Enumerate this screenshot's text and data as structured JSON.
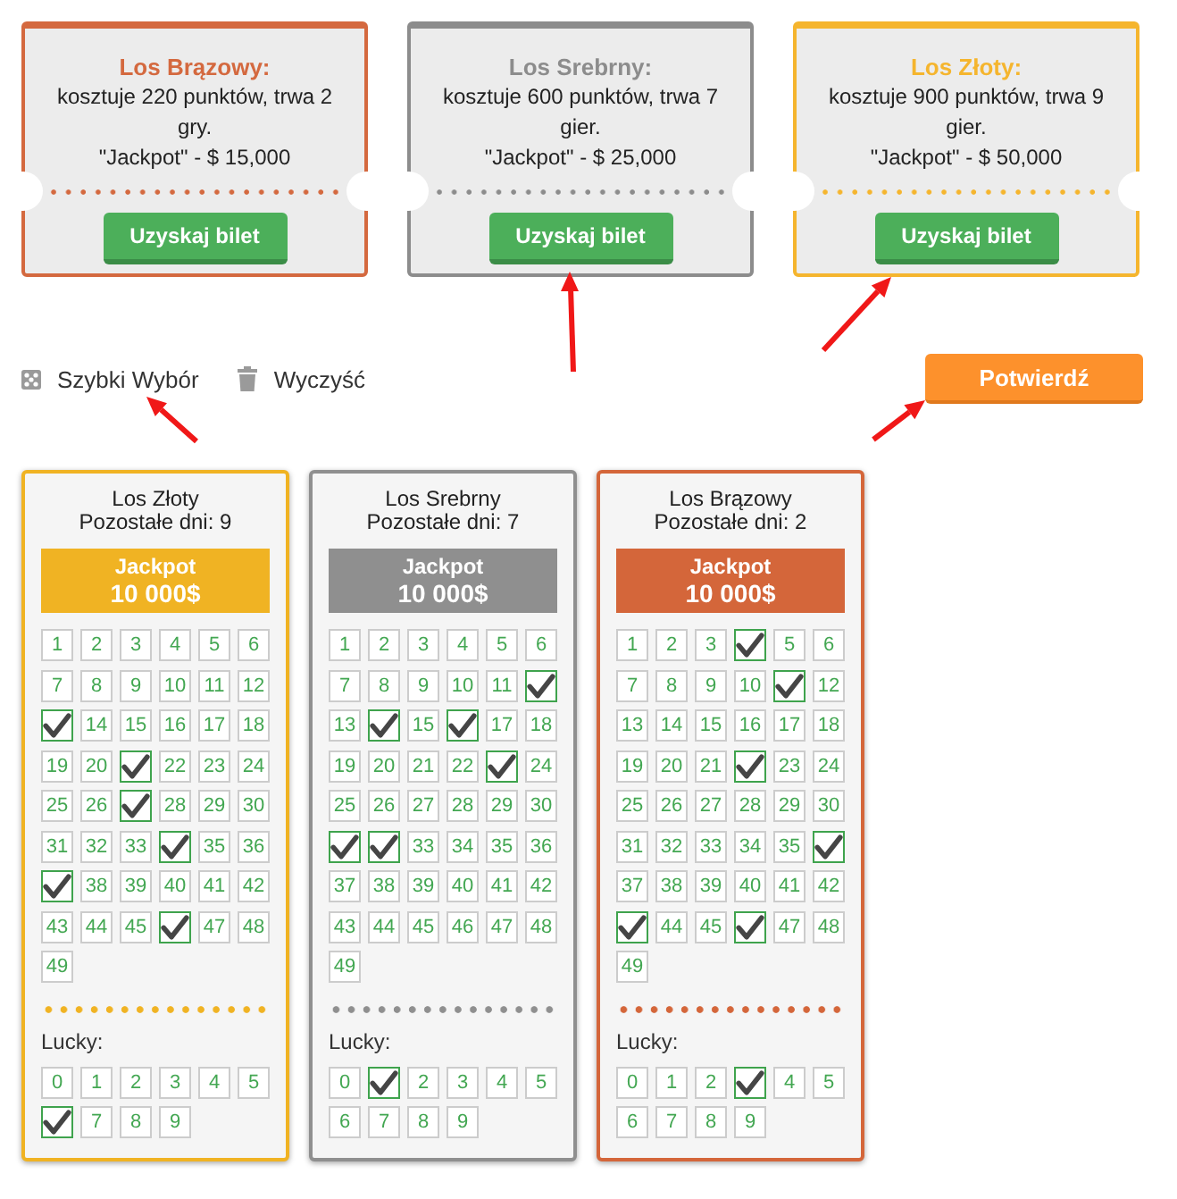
{
  "offers": [
    {
      "title": "Los Brązowy:",
      "color": "#d4693f",
      "description": "kosztuje 220 punktów, trwa 2 gry.",
      "jackpot": "\"Jackpot\" - $ 15,000",
      "button": "Uzyskaj bilet"
    },
    {
      "title": "Los Srebrny:",
      "color": "#8c8c8c",
      "description": "kosztuje 600 punktów, trwa 7 gier.",
      "jackpot": "\"Jackpot\" - $ 25,000",
      "button": "Uzyskaj bilet"
    },
    {
      "title": "Los Złoty:",
      "color": "#f5b52e",
      "description": "kosztuje 900 punktów, trwa 9 gier.",
      "jackpot": "\"Jackpot\" - $ 50,000",
      "button": "Uzyskaj bilet"
    }
  ],
  "toolbar": {
    "actions": [
      {
        "kind": "dice",
        "label": "Szybki Wybór"
      },
      {
        "kind": "trash",
        "label": "Wyczyść"
      }
    ],
    "confirm_button": "Potwierdź"
  },
  "tickets": [
    {
      "title": "Los Złoty",
      "days": "Pozostałe dni: 9",
      "color": "#f0b323",
      "jackpot_label": "Jackpot",
      "jackpot_amount": "10 000$",
      "lucky_label": "Lucky:",
      "numbers": [
        {
          "label": "1",
          "selected": false
        },
        {
          "label": "2",
          "selected": false
        },
        {
          "label": "3",
          "selected": false
        },
        {
          "label": "4",
          "selected": false
        },
        {
          "label": "5",
          "selected": false
        },
        {
          "label": "6",
          "selected": false
        },
        {
          "label": "7",
          "selected": false
        },
        {
          "label": "8",
          "selected": false
        },
        {
          "label": "9",
          "selected": false
        },
        {
          "label": "10",
          "selected": false
        },
        {
          "label": "11",
          "selected": false
        },
        {
          "label": "12",
          "selected": false
        },
        {
          "selected": true
        },
        {
          "label": "14",
          "selected": false
        },
        {
          "label": "15",
          "selected": false
        },
        {
          "label": "16",
          "selected": false
        },
        {
          "label": "17",
          "selected": false
        },
        {
          "label": "18",
          "selected": false
        },
        {
          "label": "19",
          "selected": false
        },
        {
          "label": "20",
          "selected": false
        },
        {
          "selected": true
        },
        {
          "label": "22",
          "selected": false
        },
        {
          "label": "23",
          "selected": false
        },
        {
          "label": "24",
          "selected": false
        },
        {
          "label": "25",
          "selected": false
        },
        {
          "label": "26",
          "selected": false
        },
        {
          "selected": true
        },
        {
          "label": "28",
          "selected": false
        },
        {
          "label": "29",
          "selected": false
        },
        {
          "label": "30",
          "selected": false
        },
        {
          "label": "31",
          "selected": false
        },
        {
          "label": "32",
          "selected": false
        },
        {
          "label": "33",
          "selected": false
        },
        {
          "selected": true
        },
        {
          "label": "35",
          "selected": false
        },
        {
          "label": "36",
          "selected": false
        },
        {
          "selected": true
        },
        {
          "label": "38",
          "selected": false
        },
        {
          "label": "39",
          "selected": false
        },
        {
          "label": "40",
          "selected": false
        },
        {
          "label": "41",
          "selected": false
        },
        {
          "label": "42",
          "selected": false
        },
        {
          "label": "43",
          "selected": false
        },
        {
          "label": "44",
          "selected": false
        },
        {
          "label": "45",
          "selected": false
        },
        {
          "selected": true
        },
        {
          "label": "47",
          "selected": false
        },
        {
          "label": "48",
          "selected": false
        },
        {
          "label": "49",
          "selected": false
        }
      ],
      "lucky": [
        {
          "label": "0",
          "selected": false
        },
        {
          "label": "1",
          "selected": false
        },
        {
          "label": "2",
          "selected": false
        },
        {
          "label": "3",
          "selected": false
        },
        {
          "label": "4",
          "selected": false
        },
        {
          "label": "5",
          "selected": false
        },
        {
          "selected": true
        },
        {
          "label": "7",
          "selected": false
        },
        {
          "label": "8",
          "selected": false
        },
        {
          "label": "9",
          "selected": false
        }
      ]
    },
    {
      "title": "Los Srebrny",
      "days": "Pozostałe dni: 7",
      "color": "#8f8f8f",
      "jackpot_label": "Jackpot",
      "jackpot_amount": "10 000$",
      "lucky_label": "Lucky:",
      "numbers": [
        {
          "label": "1",
          "selected": false
        },
        {
          "label": "2",
          "selected": false
        },
        {
          "label": "3",
          "selected": false
        },
        {
          "label": "4",
          "selected": false
        },
        {
          "label": "5",
          "selected": false
        },
        {
          "label": "6",
          "selected": false
        },
        {
          "label": "7",
          "selected": false
        },
        {
          "label": "8",
          "selected": false
        },
        {
          "label": "9",
          "selected": false
        },
        {
          "label": "10",
          "selected": false
        },
        {
          "label": "11",
          "selected": false
        },
        {
          "selected": true
        },
        {
          "label": "13",
          "selected": false
        },
        {
          "selected": true
        },
        {
          "label": "15",
          "selected": false
        },
        {
          "selected": true
        },
        {
          "label": "17",
          "selected": false
        },
        {
          "label": "18",
          "selected": false
        },
        {
          "label": "19",
          "selected": false
        },
        {
          "label": "20",
          "selected": false
        },
        {
          "label": "21",
          "selected": false
        },
        {
          "label": "22",
          "selected": false
        },
        {
          "selected": true
        },
        {
          "label": "24",
          "selected": false
        },
        {
          "label": "25",
          "selected": false
        },
        {
          "label": "26",
          "selected": false
        },
        {
          "label": "27",
          "selected": false
        },
        {
          "label": "28",
          "selected": false
        },
        {
          "label": "29",
          "selected": false
        },
        {
          "label": "30",
          "selected": false
        },
        {
          "selected": true
        },
        {
          "selected": true
        },
        {
          "label": "33",
          "selected": false
        },
        {
          "label": "34",
          "selected": false
        },
        {
          "label": "35",
          "selected": false
        },
        {
          "label": "36",
          "selected": false
        },
        {
          "label": "37",
          "selected": false
        },
        {
          "label": "38",
          "selected": false
        },
        {
          "label": "39",
          "selected": false
        },
        {
          "label": "40",
          "selected": false
        },
        {
          "label": "41",
          "selected": false
        },
        {
          "label": "42",
          "selected": false
        },
        {
          "label": "43",
          "selected": false
        },
        {
          "label": "44",
          "selected": false
        },
        {
          "label": "45",
          "selected": false
        },
        {
          "label": "46",
          "selected": false
        },
        {
          "label": "47",
          "selected": false
        },
        {
          "label": "48",
          "selected": false
        },
        {
          "label": "49",
          "selected": false
        }
      ],
      "lucky": [
        {
          "label": "0",
          "selected": false
        },
        {
          "selected": true
        },
        {
          "label": "2",
          "selected": false
        },
        {
          "label": "3",
          "selected": false
        },
        {
          "label": "4",
          "selected": false
        },
        {
          "label": "5",
          "selected": false
        },
        {
          "label": "6",
          "selected": false
        },
        {
          "label": "7",
          "selected": false
        },
        {
          "label": "8",
          "selected": false
        },
        {
          "label": "9",
          "selected": false
        }
      ]
    },
    {
      "title": "Los Brązowy",
      "days": "Pozostałe dni: 2",
      "color": "#d4663a",
      "jackpot_label": "Jackpot",
      "jackpot_amount": "10 000$",
      "lucky_label": "Lucky:",
      "numbers": [
        {
          "label": "1",
          "selected": false
        },
        {
          "label": "2",
          "selected": false
        },
        {
          "label": "3",
          "selected": false
        },
        {
          "selected": true
        },
        {
          "label": "5",
          "selected": false
        },
        {
          "label": "6",
          "selected": false
        },
        {
          "label": "7",
          "selected": false
        },
        {
          "label": "8",
          "selected": false
        },
        {
          "label": "9",
          "selected": false
        },
        {
          "label": "10",
          "selected": false
        },
        {
          "selected": true
        },
        {
          "label": "12",
          "selected": false
        },
        {
          "label": "13",
          "selected": false
        },
        {
          "label": "14",
          "selected": false
        },
        {
          "label": "15",
          "selected": false
        },
        {
          "label": "16",
          "selected": false
        },
        {
          "label": "17",
          "selected": false
        },
        {
          "label": "18",
          "selected": false
        },
        {
          "label": "19",
          "selected": false
        },
        {
          "label": "20",
          "selected": false
        },
        {
          "label": "21",
          "selected": false
        },
        {
          "selected": true
        },
        {
          "label": "23",
          "selected": false
        },
        {
          "label": "24",
          "selected": false
        },
        {
          "label": "25",
          "selected": false
        },
        {
          "label": "26",
          "selected": false
        },
        {
          "label": "27",
          "selected": false
        },
        {
          "label": "28",
          "selected": false
        },
        {
          "label": "29",
          "selected": false
        },
        {
          "label": "30",
          "selected": false
        },
        {
          "label": "31",
          "selected": false
        },
        {
          "label": "32",
          "selected": false
        },
        {
          "label": "33",
          "selected": false
        },
        {
          "label": "34",
          "selected": false
        },
        {
          "label": "35",
          "selected": false
        },
        {
          "selected": true
        },
        {
          "label": "37",
          "selected": false
        },
        {
          "label": "38",
          "selected": false
        },
        {
          "label": "39",
          "selected": false
        },
        {
          "label": "40",
          "selected": false
        },
        {
          "label": "41",
          "selected": false
        },
        {
          "label": "42",
          "selected": false
        },
        {
          "selected": true
        },
        {
          "label": "44",
          "selected": false
        },
        {
          "label": "45",
          "selected": false
        },
        {
          "selected": true
        },
        {
          "label": "47",
          "selected": false
        },
        {
          "label": "48",
          "selected": false
        },
        {
          "label": "49",
          "selected": false
        }
      ],
      "lucky": [
        {
          "label": "0",
          "selected": false
        },
        {
          "label": "1",
          "selected": false
        },
        {
          "label": "2",
          "selected": false
        },
        {
          "selected": true
        },
        {
          "label": "4",
          "selected": false
        },
        {
          "label": "5",
          "selected": false
        },
        {
          "label": "6",
          "selected": false
        },
        {
          "label": "7",
          "selected": false
        },
        {
          "label": "8",
          "selected": false
        },
        {
          "label": "9",
          "selected": false
        }
      ]
    }
  ]
}
